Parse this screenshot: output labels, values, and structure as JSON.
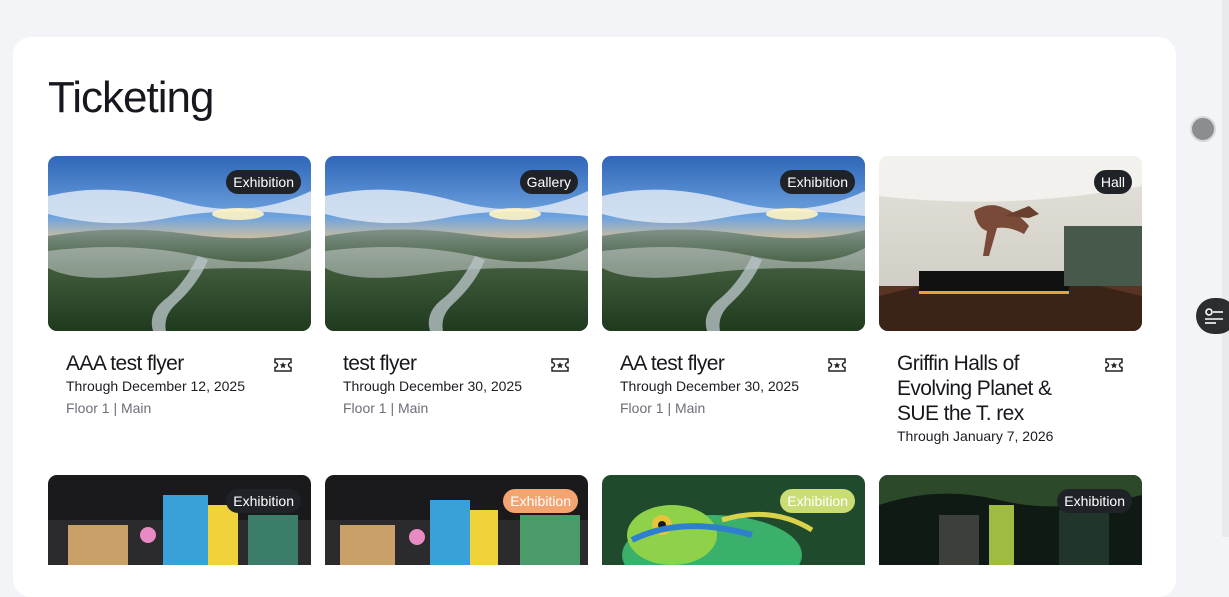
{
  "page": {
    "title": "Ticketing"
  },
  "icons": {
    "ticket": "ticket-icon",
    "filter": "filter-list-icon"
  },
  "colors": {
    "badge_dark": "#1f2227",
    "badge_orange": "#f3a470",
    "badge_lime": "#c9dd74",
    "panel": "#ffffff",
    "background": "#f3f4f8"
  },
  "cards": [
    {
      "badge": "Exhibition",
      "title": "AAA test flyer",
      "date": "Through December 12, 2025",
      "location": "Floor 1 | Main"
    },
    {
      "badge": "Gallery",
      "title": "test flyer",
      "date": "Through December 30, 2025",
      "location": "Floor 1 | Main"
    },
    {
      "badge": "Exhibition",
      "title": "AA test flyer",
      "date": "Through December 30, 2025",
      "location": "Floor 1 | Main"
    },
    {
      "badge": "Hall",
      "title": "Griffin Halls of Evolving Planet & SUE the T. rex",
      "date": "Through January 7, 2026",
      "location": ""
    },
    {
      "badge": "Exhibition"
    },
    {
      "badge": "Exhibition"
    },
    {
      "badge": "Exhibition"
    },
    {
      "badge": "Exhibition"
    }
  ]
}
